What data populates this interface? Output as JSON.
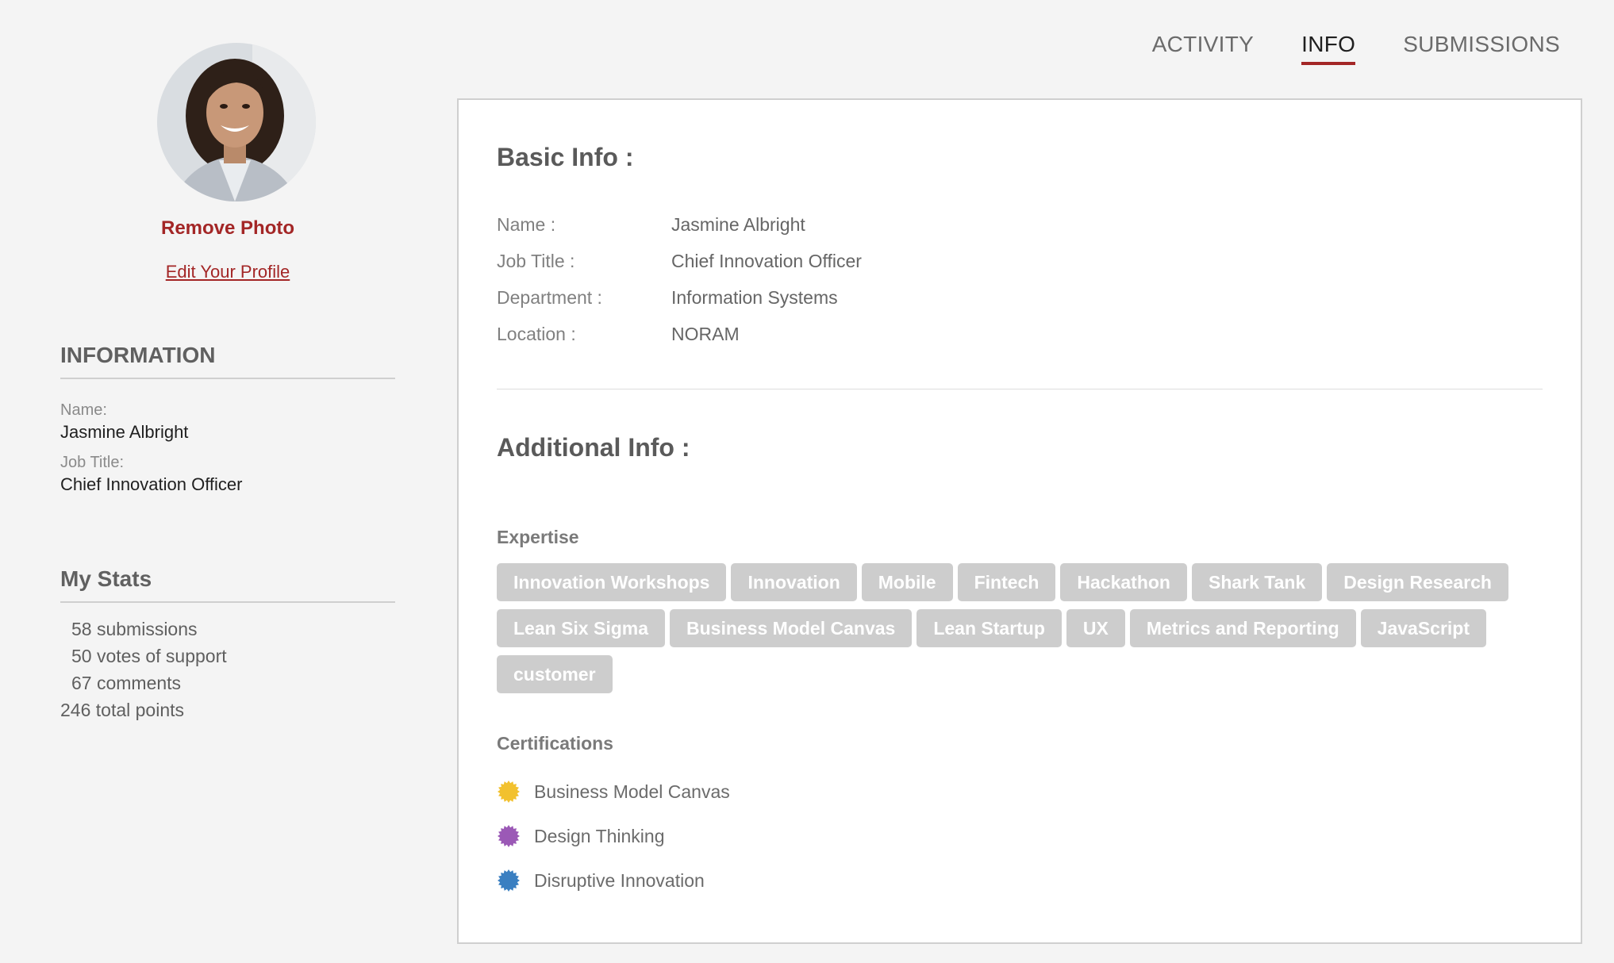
{
  "profile": {
    "remove_photo": "Remove Photo",
    "edit_profile": "Edit Your Profile"
  },
  "sidebar": {
    "information_heading": "INFORMATION",
    "fields": [
      {
        "label": "Name:",
        "value": "Jasmine Albright"
      },
      {
        "label": "Job Title:",
        "value": "Chief Innovation Officer"
      }
    ],
    "stats_heading": "My Stats",
    "stats": [
      "58 submissions",
      "50 votes of support",
      "67 comments",
      "246 total points"
    ]
  },
  "tabs": [
    {
      "label": "ACTIVITY",
      "active": false
    },
    {
      "label": "INFO",
      "active": true
    },
    {
      "label": "SUBMISSIONS",
      "active": false
    }
  ],
  "basic_info": {
    "title": "Basic Info :",
    "rows": [
      {
        "label": "Name :",
        "value": "Jasmine Albright"
      },
      {
        "label": "Job Title :",
        "value": "Chief Innovation Officer"
      },
      {
        "label": "Department :",
        "value": "Information Systems"
      },
      {
        "label": "Location :",
        "value": "NORAM"
      }
    ]
  },
  "additional_info": {
    "title": "Additional Info :",
    "expertise_label": "Expertise",
    "expertise": [
      "Innovation Workshops",
      "Innovation",
      "Mobile",
      "Fintech",
      "Hackathon",
      "Shark Tank",
      "Design Research",
      "Lean Six Sigma",
      "Business Model Canvas",
      "Lean Startup",
      "UX",
      "Metrics and Reporting",
      "JavaScript",
      "customer"
    ],
    "certifications_label": "Certifications",
    "certifications": [
      {
        "name": "Business Model Canvas",
        "icon": "badge-icon",
        "color": "#f2c12e"
      },
      {
        "name": "Design Thinking",
        "icon": "badge-icon",
        "color": "#9b59b6"
      },
      {
        "name": "Disruptive Innovation",
        "icon": "badge-icon",
        "color": "#3a7fc1"
      }
    ]
  },
  "colors": {
    "accent": "#a32626",
    "chip_bg": "#cdcdcd",
    "page_bg": "#f4f4f4"
  }
}
